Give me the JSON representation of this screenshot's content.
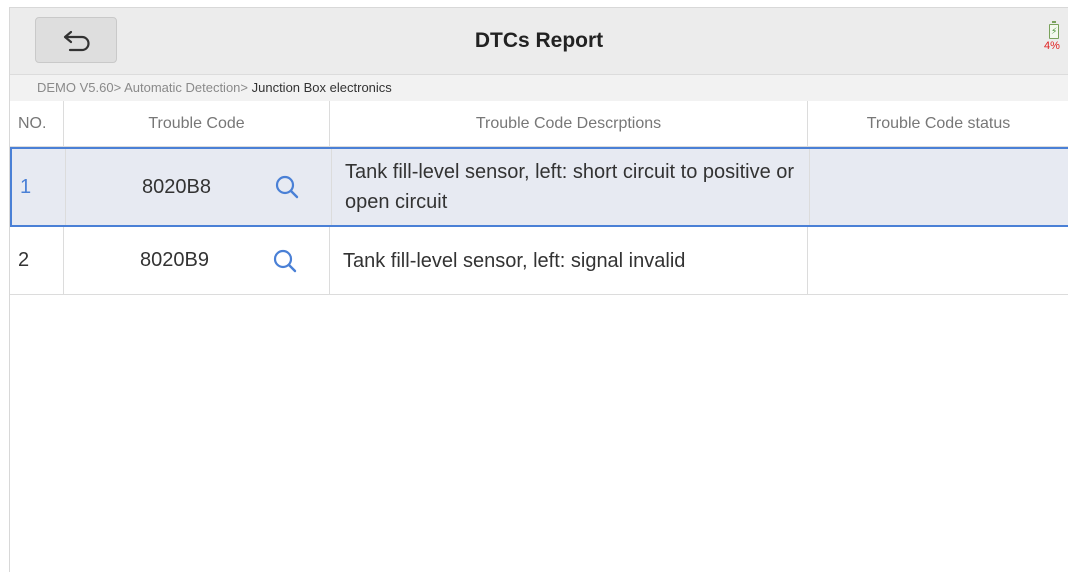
{
  "header": {
    "title": "DTCs Report",
    "battery_percent": "4%"
  },
  "breadcrumb": {
    "path": "DEMO V5.60> Automatic Detection> ",
    "current": "Junction Box electronics"
  },
  "table": {
    "columns": [
      "NO.",
      "Trouble Code",
      "Trouble Code Descrptions",
      "Trouble Code status"
    ],
    "rows": [
      {
        "no": "1",
        "code": "8020B8",
        "description": "Tank fill-level sensor, left: short circuit to positive or open circuit",
        "status": ""
      },
      {
        "no": "2",
        "code": "8020B9",
        "description": "Tank fill-level sensor, left: signal invalid",
        "status": ""
      }
    ]
  },
  "colors": {
    "accent": "#4a80d6",
    "selected_row_bg": "#e7eaf2",
    "topbar_bg": "#ececec",
    "battery_low": "#e02020"
  },
  "icons": {
    "back": "back-arrow-icon",
    "search": "search-icon",
    "battery": "battery-icon"
  }
}
